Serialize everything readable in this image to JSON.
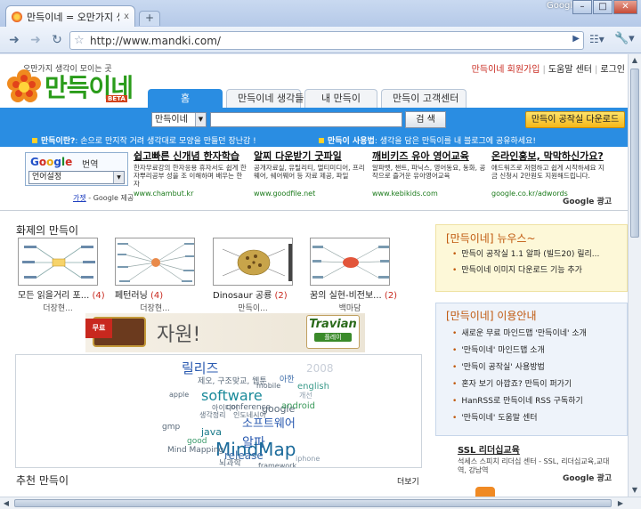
{
  "browser": {
    "tab_title": "만득이네 = 오만가지 생...",
    "tab_close": "x",
    "new_tab": "+",
    "google_label": "Google",
    "url": "http://www.mandki.com/"
  },
  "header": {
    "tagline": "오만가지 생각이 모이는 곳",
    "logo": "만득이네",
    "beta": "BETA",
    "top_links": [
      "만득이네 회원가입",
      "도움말 센터",
      "로그인"
    ]
  },
  "nav_tabs": [
    "홈",
    "만득이네 생각들",
    "내 만득이",
    "만득이 고객센터"
  ],
  "search": {
    "select_value": "만득이네",
    "button": "검 색",
    "download": "만득이 공작실 다운로드"
  },
  "info_bar": {
    "left_label": "만득이란?",
    "left_text": ": 손으로 만지작 거려 생각대로 모양을 만들던 장난감 !",
    "right_label": "만득이 사용법",
    "right_text": ": 생각을 담은 만득이를 내 블로그에 공유하세요!"
  },
  "google_translate": {
    "google": "Google",
    "word": "번역",
    "select_value": "언어설정",
    "credit_link": "가젯",
    "credit_text": " - Google 제공"
  },
  "ads": [
    {
      "title": "쉽고빠른 신개념 한자학습",
      "desc": "한자무료강의 한자응용 휴자서도 쉽게 한자뿌리공부 성을 조 이해하며 배우는 한자",
      "url": "www.chambut.kr"
    },
    {
      "title": "알찌 다운받기 굿파일",
      "desc": "공개자료실, 유틸리티, 멀티미디어, 프리웨어, 쉐어웨어 등 자료 제공, 파일",
      "url": "www.goodfile.net"
    },
    {
      "title": "깨비키즈 유아 영어교육",
      "desc": "알파벳, 챈트, 파닉스, 영어동요, 동화, 공작으로 즐거운 유아영어교육",
      "url": "www.kebikids.com"
    },
    {
      "title": "온라인홍보, 막막하신가요?",
      "desc": "애드워즈로 저렴하고 쉽게 시작하세요 지금 신청시 2만원도 지원해드립니다.",
      "url": "google.co.kr/adwords"
    }
  ],
  "google_ad_label": "Google 광고",
  "hot": {
    "title": "화제의 만득이",
    "cards": [
      {
        "title": "모든 읽을거리 포...",
        "count": "(4)",
        "author": "더장현..."
      },
      {
        "title": "페턴러닝",
        "count": "(4)",
        "author": "더장현..."
      },
      {
        "title": "Dinosaur 공룡",
        "count": "(2)",
        "author": "만득이..."
      },
      {
        "title": "꿈의 실현-비전보...",
        "count": "(2)",
        "author": "백마담"
      }
    ]
  },
  "banner": {
    "ribbon": "무료",
    "word": "자원!",
    "game": "Travian",
    "game_button": "플레이"
  },
  "tags": [
    {
      "text": "릴리즈",
      "color": "#2a5ab0",
      "size": 15
    },
    {
      "text": "2008",
      "color": "#c8ced8",
      "size": 12
    },
    {
      "text": "아한",
      "color": "#3a6aa8",
      "size": 9
    },
    {
      "text": "제오, 구조맞교, 웹툰",
      "color": "#5a6a7a",
      "size": 9
    },
    {
      "text": "english",
      "color": "#3a9a8a",
      "size": 10
    },
    {
      "text": "mobile",
      "color": "#5a6a7a",
      "size": 8
    },
    {
      "text": "apple",
      "color": "#5a6a7a",
      "size": 8
    },
    {
      "text": "software",
      "color": "#1a8a9a",
      "size": 16
    },
    {
      "text": "개선",
      "color": "#8a9aaa",
      "size": 8
    },
    {
      "text": "아이디어",
      "color": "#5a6a7a",
      "size": 8
    },
    {
      "text": "conference",
      "color": "#5a6a7a",
      "size": 9
    },
    {
      "text": "google",
      "color": "#5a6a7a",
      "size": 11
    },
    {
      "text": "android",
      "color": "#3a9a5a",
      "size": 10
    },
    {
      "text": "생각정리",
      "color": "#5a6a7a",
      "size": 8
    },
    {
      "text": "인도네시아",
      "color": "#5a6a7a",
      "size": 8
    },
    {
      "text": "소프트웨어",
      "color": "#2a5ab0",
      "size": 13
    },
    {
      "text": "java",
      "color": "#1a7a8a",
      "size": 11
    },
    {
      "text": "gmp",
      "color": "#5a6a7a",
      "size": 9
    },
    {
      "text": "알파",
      "color": "#2a5ab0",
      "size": 14
    },
    {
      "text": "MindMap",
      "color": "#1a6a9a",
      "size": 20
    },
    {
      "text": "good",
      "color": "#3a9a6a",
      "size": 9
    },
    {
      "text": "Mind Mapping",
      "color": "#5a6a7a",
      "size": 9
    },
    {
      "text": "release",
      "color": "#3a6aa8",
      "size": 12
    },
    {
      "text": "뇌과학",
      "color": "#5a6a7a",
      "size": 9
    },
    {
      "text": "iphone",
      "color": "#8a9aaa",
      "size": 8
    },
    {
      "text": "framework",
      "color": "#5a6a7a",
      "size": 8
    },
    {
      "text": "크림",
      "color": "#8a9aaa",
      "size": 8
    }
  ],
  "recommend": {
    "title": "추천 만득이",
    "more": "더보기"
  },
  "news": {
    "title": "[만득이네] 뉴우스~",
    "items": [
      "만득이 공작실 1.1 알파 (빌드20) 릴리...",
      "만득이네 이미지 다운로드 기능 추가"
    ]
  },
  "guide": {
    "title": "[만득이네] 이용안내",
    "items": [
      "새로운 무료 마인드맵 '만득이네' 소개",
      "'만득이네' 마인드맵 소개",
      "'만득이 공작실' 사용방법",
      "혼자 보기 아깝죠? 만득이 퍼가기",
      "HanRSS로 만득이네 RSS 구독하기",
      "'만득이네' 도움말 센터"
    ]
  },
  "ssl_ad": {
    "title": "SSL 리더십교육",
    "desc": "석세스 스피치 리더십 센터 - SSL, 리더십교육,교대역, 강남역"
  },
  "colors": {
    "brand_blue": "#2a8de2",
    "accent_orange": "#c0580d",
    "logo_green": "#2a9c1a",
    "count_red": "#c8281e"
  }
}
